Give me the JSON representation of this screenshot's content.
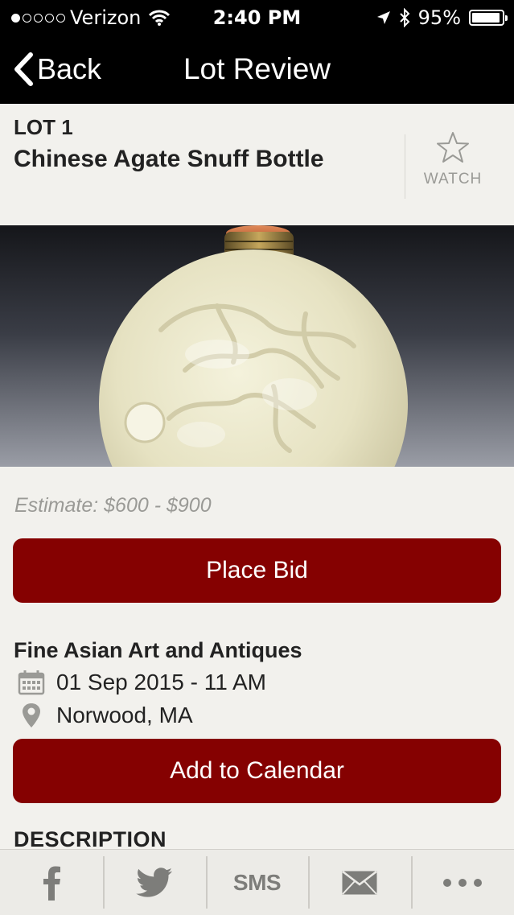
{
  "status_bar": {
    "carrier": "Verizon",
    "time": "2:40 PM",
    "battery": "95%",
    "battery_level": 0.95
  },
  "nav": {
    "back_label": "Back",
    "title": "Lot Review"
  },
  "lot": {
    "number": "LOT 1",
    "title": "Chinese Agate Snuff Bottle",
    "watch_label": "WATCH",
    "estimate": "Estimate: $600 - $900",
    "place_bid_label": "Place Bid"
  },
  "sale": {
    "title": "Fine Asian Art and Antiques",
    "date": "01 Sep 2015 - 11 AM",
    "location": "Norwood, MA",
    "add_calendar_label": "Add to Calendar"
  },
  "description_heading": "DESCRIPTION",
  "share_bar": {
    "sms_label": "SMS"
  },
  "colors": {
    "accent": "#850101",
    "nav_background": "#000000",
    "page_background": "#f2f1ed"
  },
  "icons": [
    "back-chevron-icon",
    "star-icon",
    "calendar-icon",
    "location-pin-icon",
    "facebook-icon",
    "twitter-icon",
    "mail-icon",
    "more-icon"
  ]
}
